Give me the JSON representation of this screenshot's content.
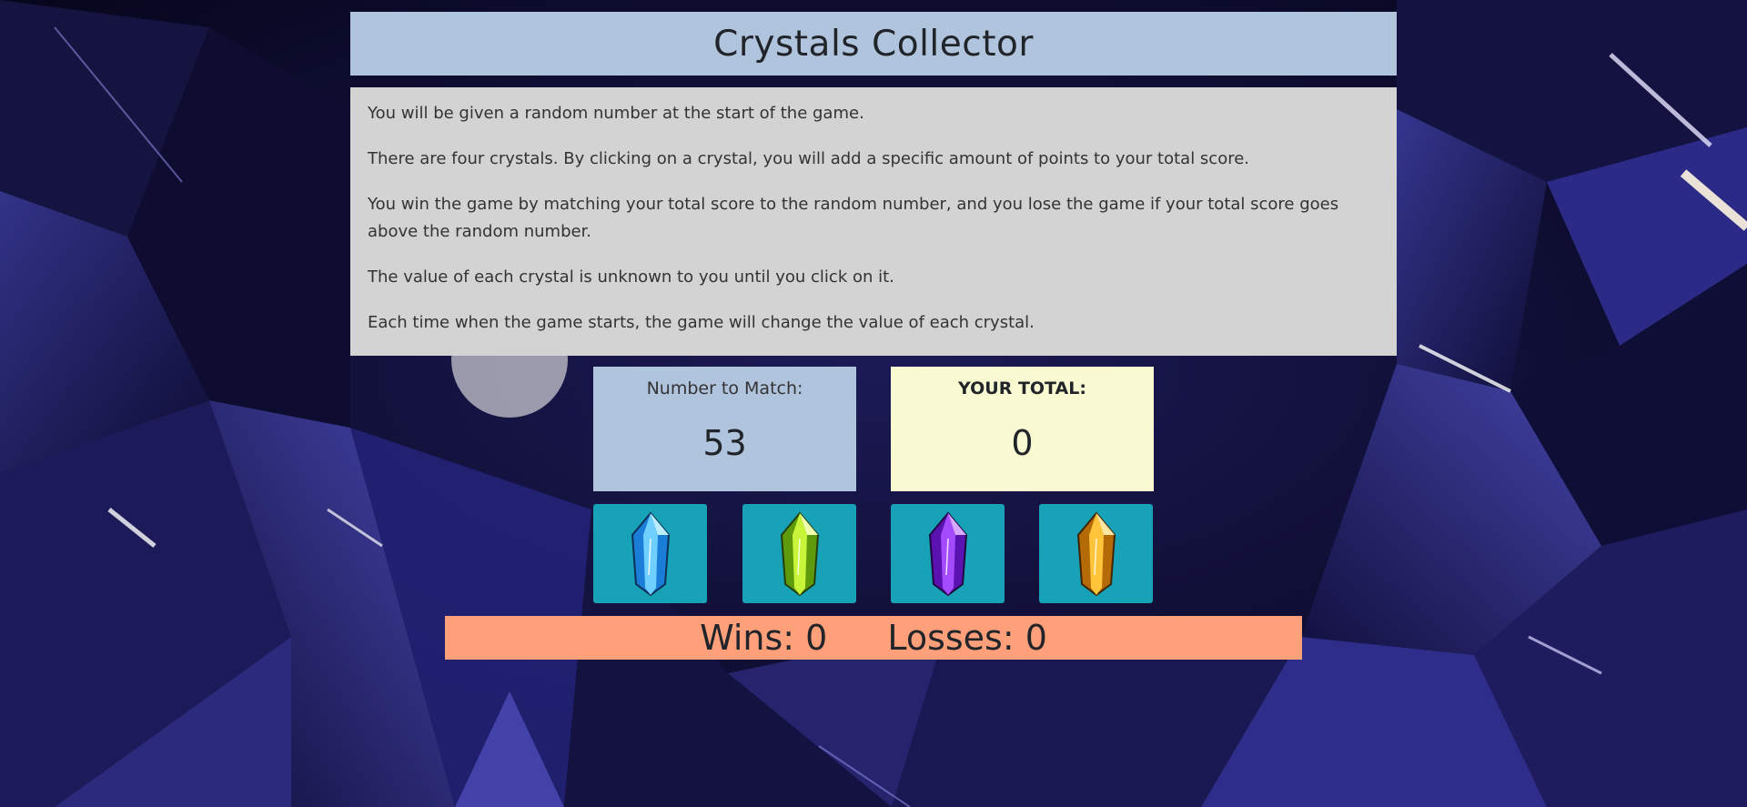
{
  "header": {
    "title": "Crystals Collector"
  },
  "instructions": [
    "You will be given a random number at the start of the game.",
    "There are four crystals. By clicking on a crystal, you will add a specific amount of points to your total score.",
    "You win the game by matching your total score to the random number, and you lose the game if your total score goes above the random number.",
    "The value of each crystal is unknown to you until you click on it.",
    "Each time when the game starts, the game will change the value of each crystal."
  ],
  "match": {
    "label": "Number to Match:",
    "value": "53"
  },
  "total": {
    "label": "YOUR TOTAL:",
    "value": "0"
  },
  "crystals": [
    {
      "icon": "blue-crystal-icon",
      "color": "#3fb8ff"
    },
    {
      "icon": "green-crystal-icon",
      "color": "#b6f21e"
    },
    {
      "icon": "purple-crystal-icon",
      "color": "#9b2bff"
    },
    {
      "icon": "orange-crystal-icon",
      "color": "#ffb21a"
    }
  ],
  "record": {
    "wins_label": "Wins: 0",
    "losses_label": "Losses: 0"
  },
  "colors": {
    "title_bg": "#b0c4de",
    "instructions_bg": "#d3d3d3",
    "match_bg": "#b0c4de",
    "total_bg": "#fafad2",
    "crystal_bg": "#17a2b8",
    "record_bg": "#ffa07a"
  }
}
